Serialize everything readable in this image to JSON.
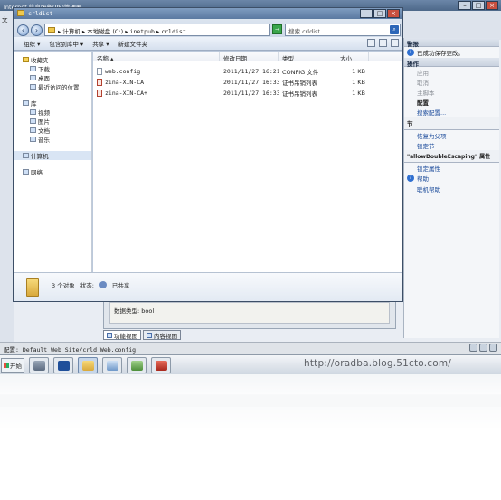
{
  "iis": {
    "title": "Internet 信息服务(IIS)管理器",
    "menu_first": "文",
    "actions": {
      "alerts_header": "警报",
      "alert_text": "已成功保存更改。",
      "ops_header": "操作",
      "apply": "应用",
      "cancel": "取消",
      "main_script": "主脚本",
      "config_header": "配置",
      "search_config": "搜索配置...",
      "section_header": "节",
      "revert_parent": "恢复为父项",
      "lock_section": "锁定节",
      "attr_header": "\"allowDoubleEscaping\" 属性",
      "lock_attr": "锁定属性",
      "help": "帮助",
      "online_help": "联机帮助"
    },
    "data_type": "数据类型: bool",
    "view_tabs": [
      "功能视图",
      "内容视图"
    ],
    "status": "配置: Default Web Site/crld Web.config"
  },
  "explorer": {
    "title": "crldist",
    "address_parts": [
      "计算机",
      "本地磁盘 (C:)",
      "inetpub",
      "crldist"
    ],
    "search_placeholder": "搜索 crldist",
    "toolbar": [
      "组织",
      "包含到库中",
      "共享",
      "新建文件夹"
    ],
    "nav": {
      "favorites": "收藏夹",
      "downloads": "下载",
      "desktop": "桌面",
      "recent": "最近访问的位置",
      "libraries": "库",
      "videos": "视频",
      "pictures": "图片",
      "documents": "文档",
      "music": "音乐",
      "computer": "计算机",
      "network": "网络"
    },
    "columns": [
      "名称",
      "修改日期",
      "类型",
      "大小"
    ],
    "files": [
      {
        "name": "web.config",
        "date": "2011/11/27 16:21",
        "type": "CONFIG 文件",
        "size": "1 KB",
        "icon": "config-file"
      },
      {
        "name": "zina-XIN-CA",
        "date": "2011/11/27 16:33",
        "type": "证书吊销列表",
        "size": "1 KB",
        "icon": "crl-file"
      },
      {
        "name": "zina-XIN-CA+",
        "date": "2011/11/27 16:33",
        "type": "证书吊销列表",
        "size": "1 KB",
        "icon": "crl-file"
      }
    ],
    "details": {
      "count": "3 个对象",
      "state_label": "状态:",
      "state_value": "已共享"
    }
  },
  "taskbar": {
    "start": "开始"
  },
  "watermark": "http://oradba.blog.51cto.com/"
}
